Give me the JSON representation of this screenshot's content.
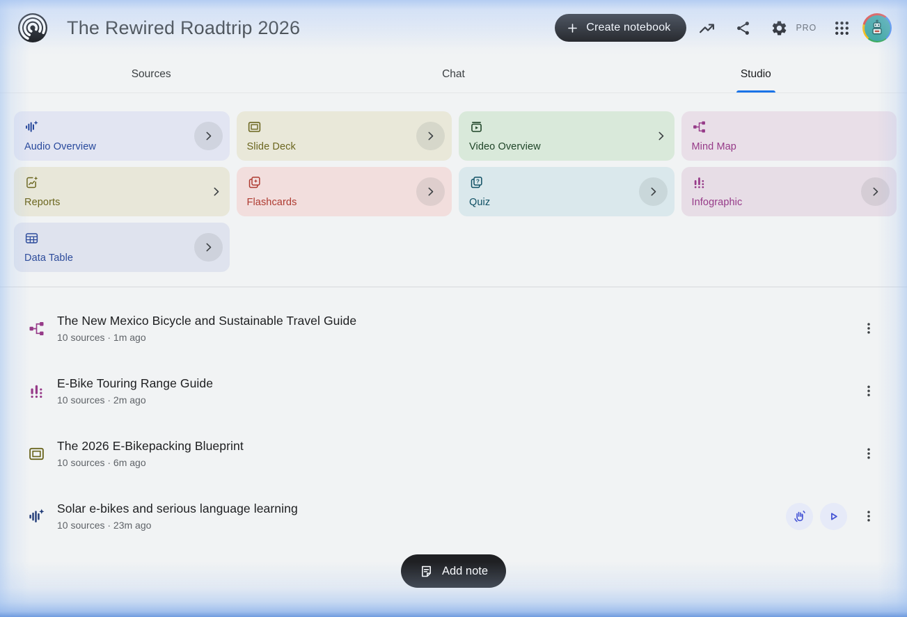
{
  "header": {
    "title": "The Rewired Roadtrip 2026",
    "create_button_label": "Create notebook",
    "pro_badge": "PRO",
    "icons": [
      "notebooklm-logo",
      "plus-icon",
      "trending-up-icon",
      "share-icon",
      "settings-gear-icon",
      "apps-grid-icon",
      "account-avatar"
    ]
  },
  "tabs": [
    {
      "label": "Sources",
      "active": false
    },
    {
      "label": "Chat",
      "active": false
    },
    {
      "label": "Studio",
      "active": true
    }
  ],
  "studio_cards": [
    {
      "label": "Audio Overview",
      "icon": "audio-waveform-icon",
      "bg": "#e2e5f2",
      "fg": "#27489c",
      "chevron": "circled"
    },
    {
      "label": "Slide Deck",
      "icon": "slide-deck-icon",
      "bg": "#e9e8d9",
      "fg": "#6b661f",
      "chevron": "circled"
    },
    {
      "label": "Video Overview",
      "icon": "video-overview-icon",
      "bg": "#d9e9da",
      "fg": "#1e4427",
      "chevron": "plain"
    },
    {
      "label": "Mind Map",
      "icon": "mind-map-icon",
      "bg": "#e9dfe8",
      "fg": "#963a88",
      "chevron": "none"
    },
    {
      "label": "Reports",
      "icon": "report-icon",
      "bg": "#e8e7d9",
      "fg": "#6b661f",
      "chevron": "plain"
    },
    {
      "label": "Flashcards",
      "icon": "flashcards-icon",
      "bg": "#f2dedd",
      "fg": "#ae3a30",
      "chevron": "circled"
    },
    {
      "label": "Quiz",
      "icon": "quiz-icon",
      "bg": "#dae8ec",
      "fg": "#0e4f63",
      "chevron": "circled"
    },
    {
      "label": "Infographic",
      "icon": "infographic-icon",
      "bg": "#e7dde6",
      "fg": "#963a88",
      "chevron": "circled"
    },
    {
      "label": "Data Table",
      "icon": "data-table-icon",
      "bg": "#dfe3ee",
      "fg": "#2c4b9b",
      "chevron": "circled"
    }
  ],
  "artifacts": [
    {
      "title": "The New Mexico Bicycle and Sustainable Travel Guide",
      "meta": "10 sources · 1m ago",
      "icon": "mind-map-icon"
    },
    {
      "title": "E-Bike Touring Range Guide",
      "meta": "10 sources · 2m ago",
      "icon": "infographic-icon"
    },
    {
      "title": "The 2026 E-Bikepacking Blueprint",
      "meta": "10 sources · 6m ago",
      "icon": "slide-deck-icon"
    },
    {
      "title": "Solar e-bikes and serious language learning",
      "meta": "10 sources · 23m ago",
      "icon": "audio-waveform-icon",
      "actions": [
        "interactive-mode-button",
        "play-button",
        "more-options"
      ]
    }
  ],
  "add_note_button_label": "Add note",
  "colors": {
    "accent_blue": "#1a73e8",
    "pill_black": "#1f2023",
    "page_bg": "#f1f3f4",
    "edge_glow_blue": "#a5c3f0",
    "action_circle_bg": "#e6eaf8",
    "action_icon_blue": "#4453d4",
    "meta_text": "#5f6368"
  }
}
